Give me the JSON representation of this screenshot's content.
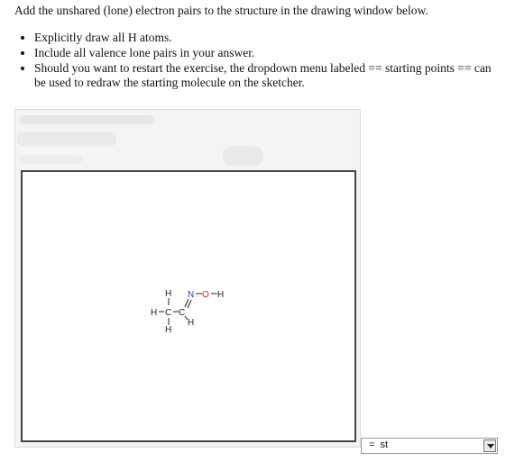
{
  "instructions": {
    "heading": "Add the unshared (lone) electron pairs to the structure in the drawing window below.",
    "bullets": [
      "Explicitly draw all H atoms.",
      "Include all valence lone pairs in your answer.",
      "Should you want to restart the exercise, the dropdown menu labeled == starting points == can be used to redraw the starting molecule on the sketcher."
    ]
  },
  "molecule": {
    "atoms": {
      "h_top": "H",
      "n": "N",
      "o": "O",
      "h_oh": "H",
      "h_left": "H",
      "c1": "C",
      "c2": "C",
      "h_bottom": "H",
      "h_c2": "H"
    }
  },
  "dropdown": {
    "selected": "=  st"
  },
  "colors": {
    "nitrogen": "#1f3fd6",
    "oxygen": "#e0241b",
    "canvas_border": "#444444"
  }
}
